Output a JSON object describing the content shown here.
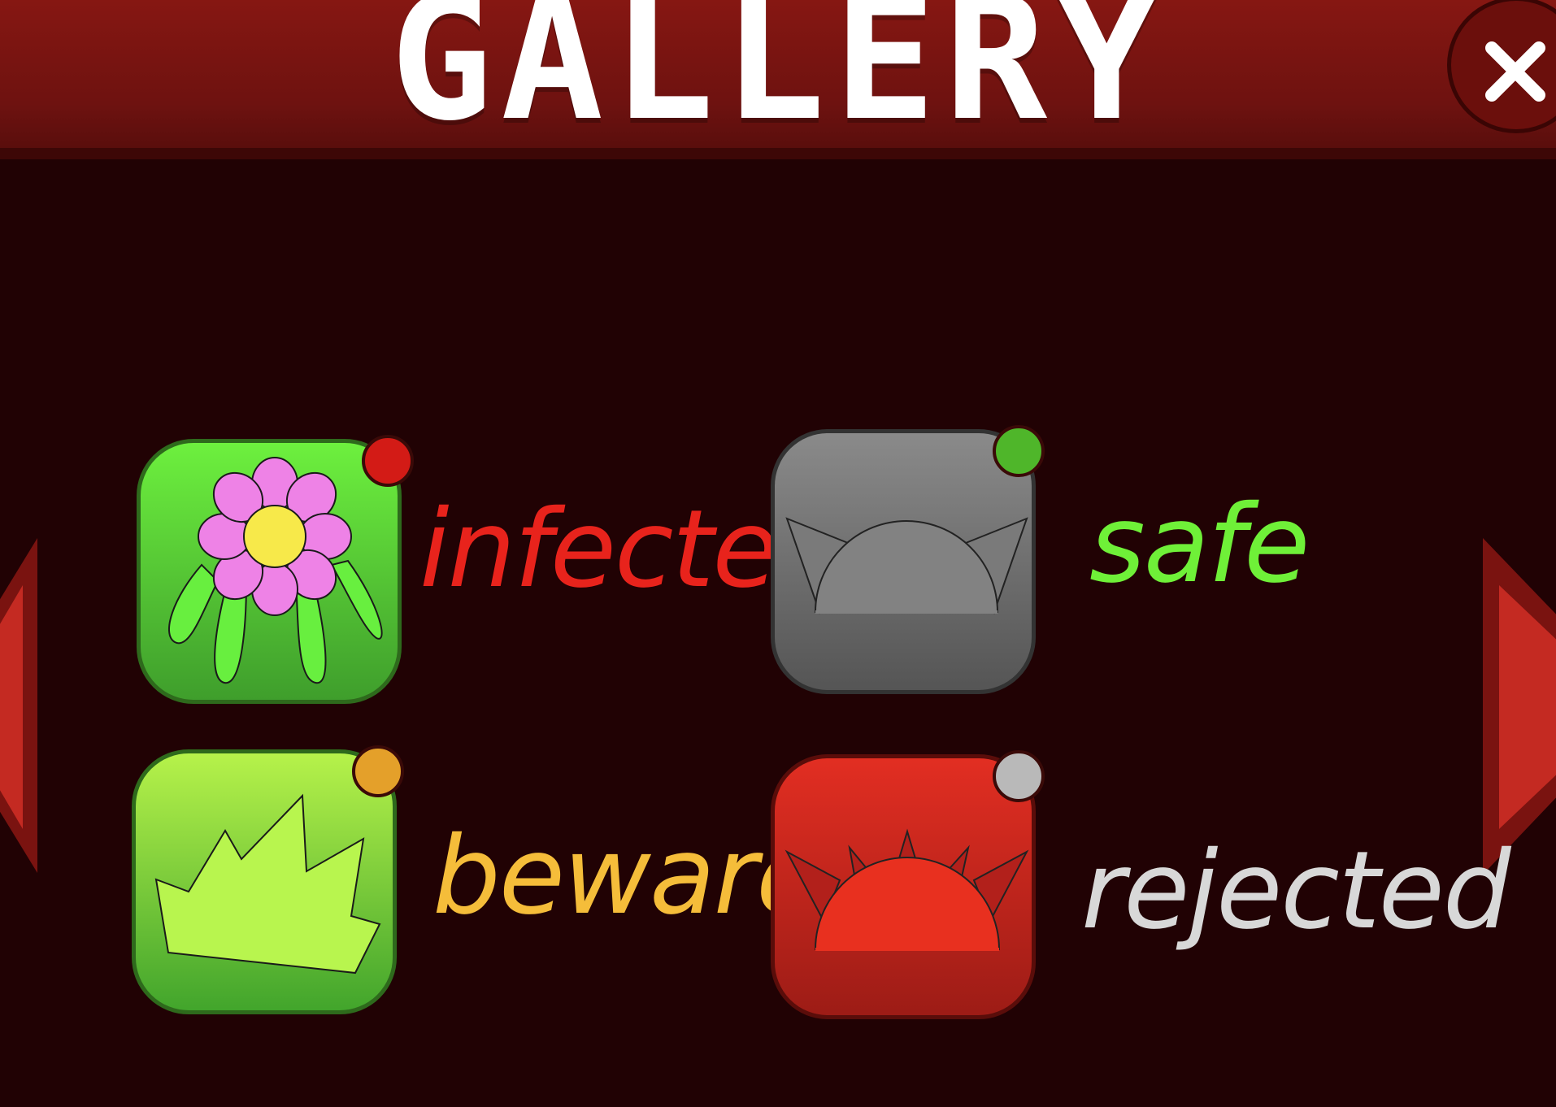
{
  "header": {
    "title": "GALLERY"
  },
  "close": {
    "icon": "close-icon"
  },
  "nav": {
    "prev_icon": "arrow-left-icon",
    "next_icon": "arrow-right-icon"
  },
  "items": [
    {
      "label": "infected",
      "label_color": "#e8231c",
      "dot_color": "#d31b16",
      "icon": "flower-creature-icon"
    },
    {
      "label": "safe",
      "label_color": "#6ff038",
      "dot_color": "#4fb62a",
      "icon": "cat-ears-creature-icon"
    },
    {
      "label": "beware",
      "label_color": "#f5bd3a",
      "dot_color": "#e4a02a",
      "icon": "jagged-grass-icon"
    },
    {
      "label": "rejected",
      "label_color": "#d8d8d8",
      "dot_color": "#b9b9b9",
      "icon": "spiked-creature-icon"
    }
  ]
}
